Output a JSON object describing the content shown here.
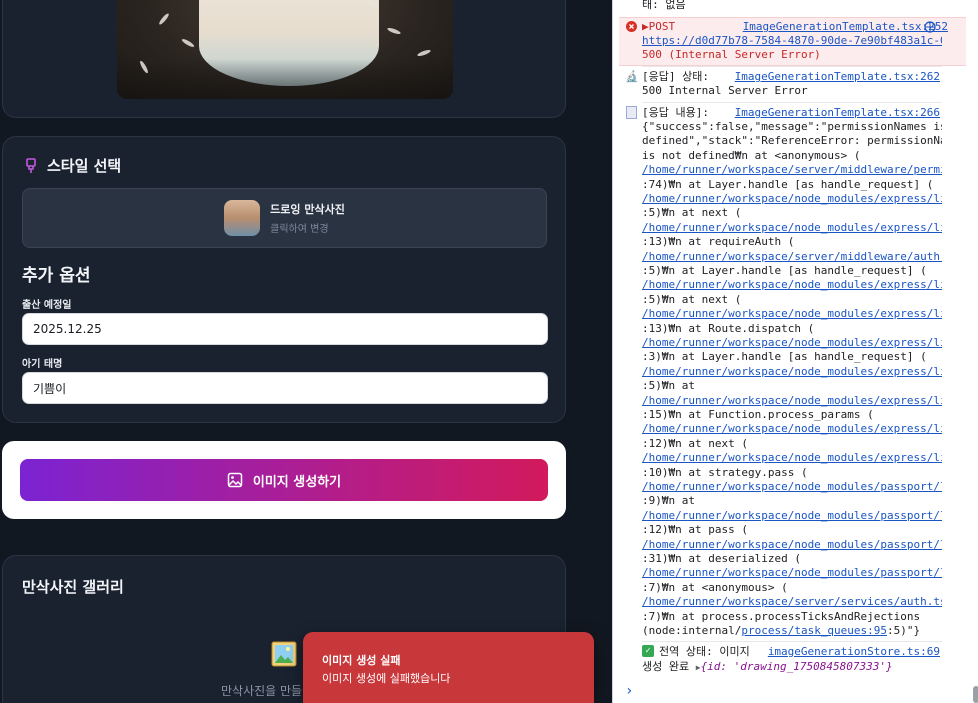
{
  "app": {
    "style": {
      "title": "스타일 선택",
      "selected_name": "드로잉 만삭사진",
      "selected_hint": "클릭하여 변경"
    },
    "options": {
      "title": "추가 옵션",
      "due_date_label": "출산 예정일",
      "due_date_value": "2025.12.25",
      "nickname_label": "아기 태명",
      "nickname_value": "기쁨이"
    },
    "generate_button": "이미지 생성하기",
    "gallery": {
      "title": "만삭사진 갤러리",
      "empty_text": "만삭사진을 만들어"
    },
    "toast": {
      "title": "이미지 생성 실패",
      "message": "이미지 생성에 실패했습니다"
    }
  },
  "console": {
    "top_line": "태: 없음",
    "error": {
      "method": "POST",
      "source": "ImageGenerationTemplate.tsx:252",
      "url": "https://d0d77b78-7584-4870-90de-7e90bf483a1c-00-…",
      "status": "500 (Internal Server Error)"
    },
    "log1": {
      "text": "[응답] 상태:",
      "source": "ImageGenerationTemplate.tsx:262",
      "line2": "500 Internal Server Error"
    },
    "log2": {
      "text": "[응답 내용]:",
      "source": "ImageGenerationTemplate.tsx:266"
    },
    "body_lines": [
      {
        "t": "{\"success\":false,\"message\":\"permissionNames is not",
        "link": false
      },
      {
        "t": "defined\",\"stack\":\"ReferenceError: permissionNames",
        "link": false
      },
      {
        "t": "is not defined₩n    at <anonymous> (",
        "link": false
      },
      {
        "t": "/home/runner/workspace/server/middleware/permiss…",
        "link": true
      },
      {
        "t": ":74)₩n    at Layer.handle [as handle_request] (",
        "link": false
      },
      {
        "t": "/home/runner/workspace/node_modules/express/lib/…",
        "link": true
      },
      {
        "t": ":5)₩n    at next (",
        "link": false
      },
      {
        "t": "/home/runner/workspace/node_modules/express/lib/…",
        "link": true
      },
      {
        "t": ":13)₩n    at requireAuth (",
        "link": false
      },
      {
        "t": "/home/runner/workspace/server/middleware/auth.ts…",
        "link": true
      },
      {
        "t": ":5)₩n    at Layer.handle [as handle_request] (",
        "link": false
      },
      {
        "t": "/home/runner/workspace/node_modules/express/lib/…",
        "link": true
      },
      {
        "t": ":5)₩n    at next (",
        "link": false
      },
      {
        "t": "/home/runner/workspace/node_modules/express/lib/…",
        "link": true
      },
      {
        "t": ":13)₩n    at Route.dispatch (",
        "link": false
      },
      {
        "t": "/home/runner/workspace/node_modules/express/lib/…",
        "link": true
      },
      {
        "t": ":3)₩n    at Layer.handle [as handle_request] (",
        "link": false
      },
      {
        "t": "/home/runner/workspace/node_modules/express/lib/…",
        "link": true
      },
      {
        "t": ":5)₩n    at",
        "link": false
      },
      {
        "t": "/home/runner/workspace/node_modules/express/lib/…",
        "link": true
      },
      {
        "t": ":15)₩n    at Function.process_params (",
        "link": false
      },
      {
        "t": "/home/runner/workspace/node_modules/express/lib/…",
        "link": true
      },
      {
        "t": ":12)₩n    at next (",
        "link": false
      },
      {
        "t": "/home/runner/workspace/node_modules/express/lib/…",
        "link": true
      },
      {
        "t": ":10)₩n    at strategy.pass (",
        "link": false
      },
      {
        "t": "/home/runner/workspace/node_modules/passport/lib…",
        "link": true
      },
      {
        "t": ":9)₩n    at",
        "link": false
      },
      {
        "t": "/home/runner/workspace/node_modules/passport/lib…",
        "link": true
      },
      {
        "t": ":12)₩n    at pass (",
        "link": false
      },
      {
        "t": "/home/runner/workspace/node_modules/passport/lib…",
        "link": true
      },
      {
        "t": ":31)₩n    at deserialized (",
        "link": false
      },
      {
        "t": "/home/runner/workspace/node_modules/passport/lib…",
        "link": true
      },
      {
        "t": ":7)₩n    at <anonymous> (",
        "link": false
      },
      {
        "t": "/home/runner/workspace/server/services/auth.ts:103",
        "link": true
      },
      {
        "t": ":7)₩n    at process.processTicksAndRejections",
        "link": false
      }
    ],
    "last_body_prefix": "(node:internal/",
    "last_body_link": "process/task_queues:95",
    "last_body_suffix": ":5)\"}",
    "log3": {
      "text": "전역 상태: 이미지",
      "source": "imageGenerationStore.ts:69",
      "line2": "생성 완료",
      "obj": "{id: 'drawing_1750845807333'}"
    },
    "prompt": "›"
  }
}
